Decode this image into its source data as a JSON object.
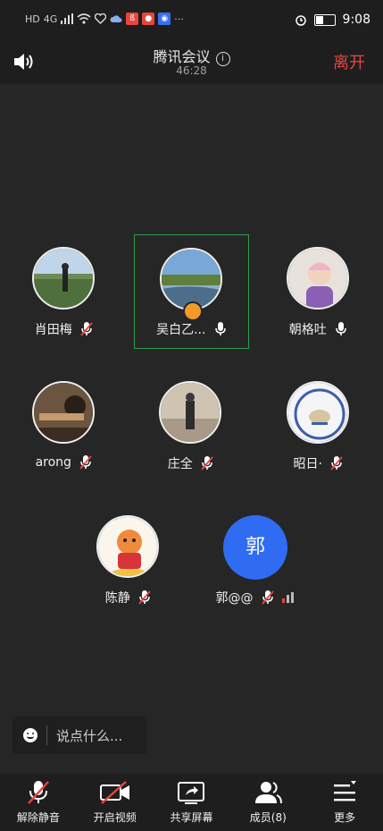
{
  "status_bar": {
    "net_badge": "HD",
    "net_gen": "4G",
    "more": "···",
    "time": "9:08",
    "colors": {
      "red_chip": "#e8453c",
      "blue_chip": "#3a6ff0"
    }
  },
  "header": {
    "title": "腾讯会议",
    "timer": "46:28",
    "leave_label": "离开",
    "leave_color": "#e8453c"
  },
  "participants": [
    {
      "name": "肖田梅",
      "mic": "muted",
      "avatar": "photo-field"
    },
    {
      "name": "吴白乙...",
      "mic": "on",
      "avatar": "photo-landscape",
      "host": true,
      "speaking": true
    },
    {
      "name": "朝格吐",
      "mic": "on",
      "avatar": "photo-child"
    },
    {
      "name": "arong",
      "mic": "muted",
      "avatar": "photo-person"
    },
    {
      "name": "庄全",
      "mic": "muted",
      "avatar": "photo-standing"
    },
    {
      "name": "昭日·",
      "mic": "muted",
      "avatar": "photo-logo"
    },
    {
      "name": "‌陈静",
      "mic": "muted",
      "avatar": "cartoon-tiger"
    },
    {
      "name": "郭@@",
      "mic": "muted",
      "avatar_letter": "郭",
      "avatar_color": "#2f6cf2",
      "signal": "weak"
    }
  ],
  "chat": {
    "placeholder": "说点什么..."
  },
  "toolbar": {
    "unmute": "解除静音",
    "start_video": "开启视频",
    "share_screen": "共享屏幕",
    "members": "成员(8)",
    "more": "更多"
  }
}
